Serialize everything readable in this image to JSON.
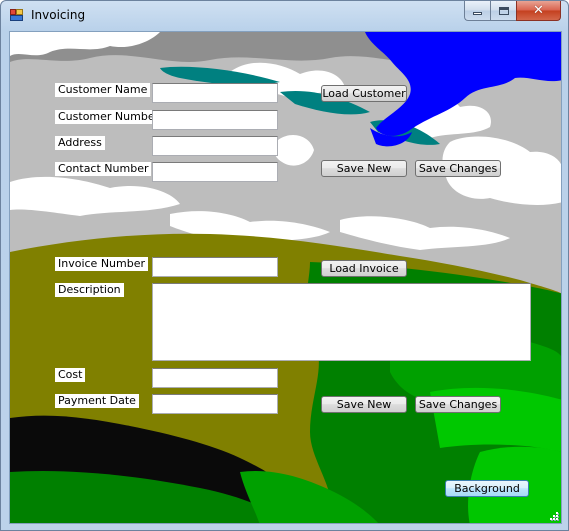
{
  "window": {
    "title": "Invoicing"
  },
  "customer": {
    "name_label": "Customer Name",
    "number_label": "Customer Number",
    "address_label": "Address",
    "contact_label": "Contact Number",
    "name_value": "",
    "number_value": "",
    "address_value": "",
    "contact_value": "",
    "load_button": "Load Customer",
    "save_new_button": "Save New",
    "save_changes_button": "Save Changes"
  },
  "invoice": {
    "number_label": "Invoice Number",
    "description_label": "Description",
    "cost_label": "Cost",
    "payment_date_label": "Payment Date",
    "number_value": "",
    "description_value": "",
    "cost_value": "",
    "payment_date_value": "",
    "load_button": "Load Invoice",
    "save_new_button": "Save New",
    "save_changes_button": "Save Changes"
  },
  "footer": {
    "background_button": "Background"
  },
  "colors": {
    "sky": "#bdbdbd",
    "cloud": "#ffffff",
    "blue_sky": "#0000ff",
    "teal": "#008080",
    "hill_olive": "#808000",
    "grass_green": "#008000",
    "lime": "#00ff00",
    "dark": "#000000"
  }
}
